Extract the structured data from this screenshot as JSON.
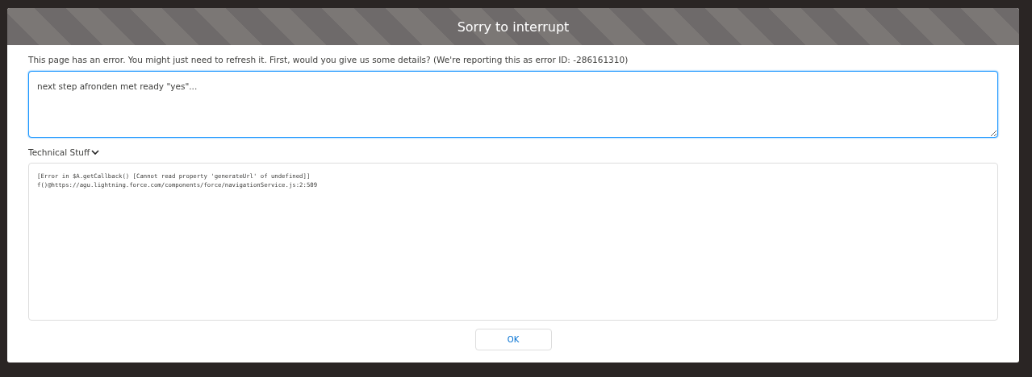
{
  "dialog": {
    "title": "Sorry to interrupt",
    "message": "This page has an error. You might just need to refresh it. First, would you give us some details? (We're reporting this as error ID: -286161310)",
    "details_field": {
      "value": "next step afronden met ready \"yes\"..."
    },
    "technical_section": {
      "label": "Technical Stuff",
      "expanded": true,
      "lines": [
        "[Error in $A.getCallback() [Cannot read property 'generateUrl' of undefined]]",
        "f()@https://agu.lightning.force.com/components/force/navigationService.js:2:509"
      ]
    },
    "buttons": [
      "OK"
    ]
  }
}
